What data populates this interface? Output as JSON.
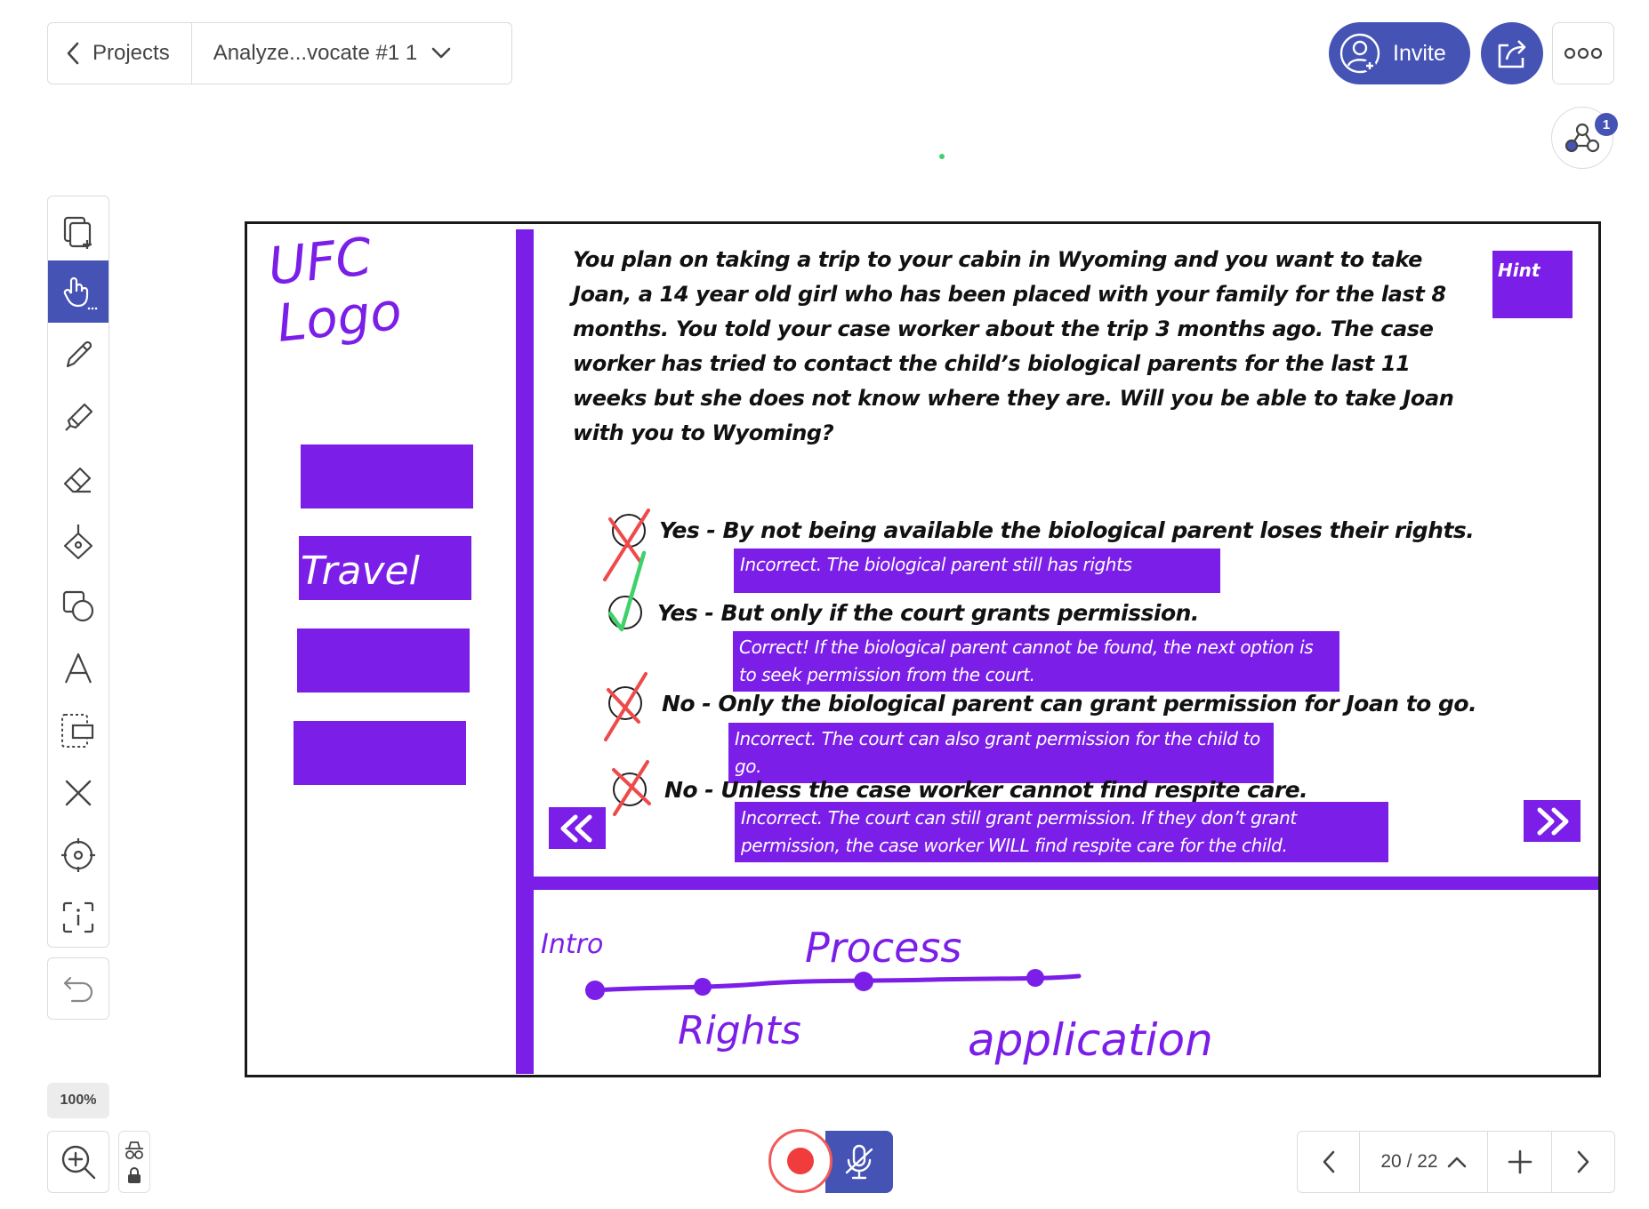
{
  "header": {
    "back_label": "Projects",
    "project_title": "Analyze...vocate #1 1",
    "invite_label": "Invite",
    "collab_count": "1"
  },
  "toolbar": {
    "zoom_level": "100%"
  },
  "slide": {
    "handwritten_logo": "UFC Logo",
    "sidebar_travel": "Travel",
    "question": "You plan on taking a trip to your cabin in Wyoming and you want to take Joan, a 14 year old girl who has been placed with your family for the last 8 months. You told your case worker about the trip 3 months ago. The case worker has tried to contact the child’s biological parents for the last 11 weeks but she does not know where they are. Will you be able to take Joan with you to Wyoming?",
    "hint_label": "Hint",
    "answers": [
      {
        "text": "Yes - By not being available the biological parent loses their rights.",
        "feedback": "Incorrect. The biological parent still has rights",
        "status": "incorrect"
      },
      {
        "text": "Yes - But only if the court grants permission.",
        "feedback": "Correct! If the biological parent cannot be found, the next option is to seek permission from the court.",
        "status": "correct"
      },
      {
        "text": "No - Only the biological parent can grant permission for Joan to go.",
        "feedback": "Incorrect. The court can also grant permission for the child to go.",
        "status": "incorrect"
      },
      {
        "text": "No - Unless the case worker cannot find respite care.",
        "feedback": "Incorrect. The court can still grant permission. If they don’t grant permission, the case worker WILL find respite care for the child.",
        "status": "incorrect"
      }
    ],
    "timeline": {
      "intro": "Intro",
      "rights": "Rights",
      "process": "Process",
      "application": "application"
    }
  },
  "pager": {
    "page_label": "20 / 22"
  },
  "colors": {
    "brand": "#4553b5",
    "slide_purple": "#7a1ee8",
    "incorrect_mark": "#ef4a4a",
    "correct_mark": "#3fd16a",
    "record": "#f03c3c"
  }
}
